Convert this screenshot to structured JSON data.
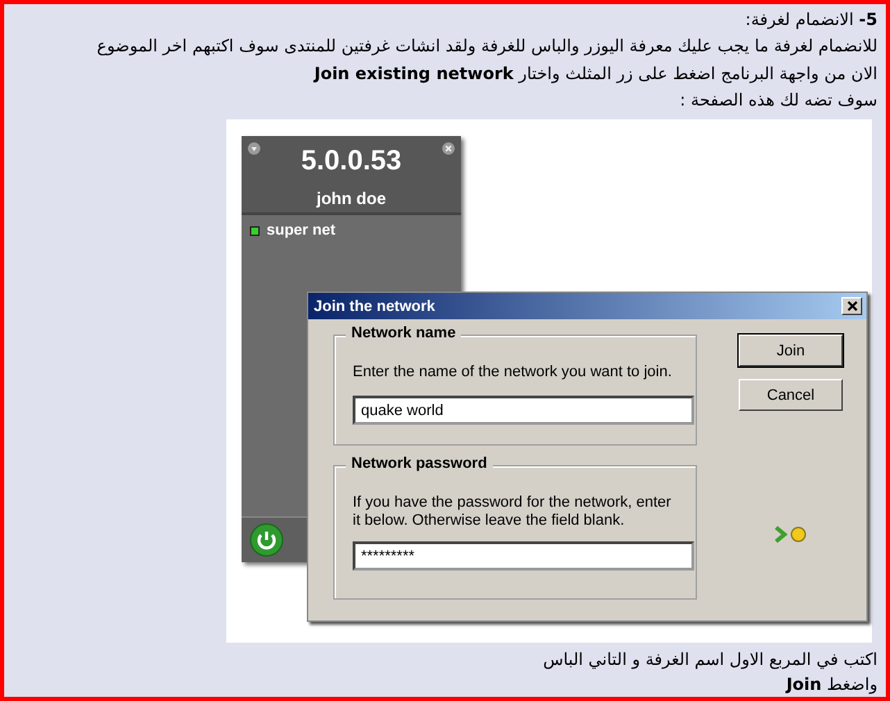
{
  "intro": [
    "**5-** الانضمام لغرفة:",
    "للانضمام لغرفة ما يجب عليك معرفة اليوزر والباس للغرفة ولقد انشات غرفتين للمنتدى سوف اكتبهم اخر الموضوع",
    "الان من واجهة البرنامج اضغط على زر المثلث واختار **Join existing network**",
    "سوف تضه لك هذه الصفحة :"
  ],
  "hamachi": {
    "version": "5.0.0.53",
    "user": "john doe",
    "networks": [
      {
        "name": "super net",
        "online": true
      }
    ]
  },
  "dialog": {
    "title": "Join the network",
    "groups": [
      {
        "title": "Network name",
        "hint": "Enter the name of the network you want to join.",
        "value": "quake world"
      },
      {
        "title": "Network password",
        "hint": "If you have the password for the network, enter it below. Otherwise leave the field blank.",
        "value": "*********"
      }
    ],
    "buttons": [
      {
        "label": "Join",
        "default": true
      },
      {
        "label": "Cancel",
        "default": false
      }
    ]
  },
  "outro": [
    "اكتب في المربع الاول اسم الغرفة و التاني الباس",
    "واضغط **Join**"
  ]
}
